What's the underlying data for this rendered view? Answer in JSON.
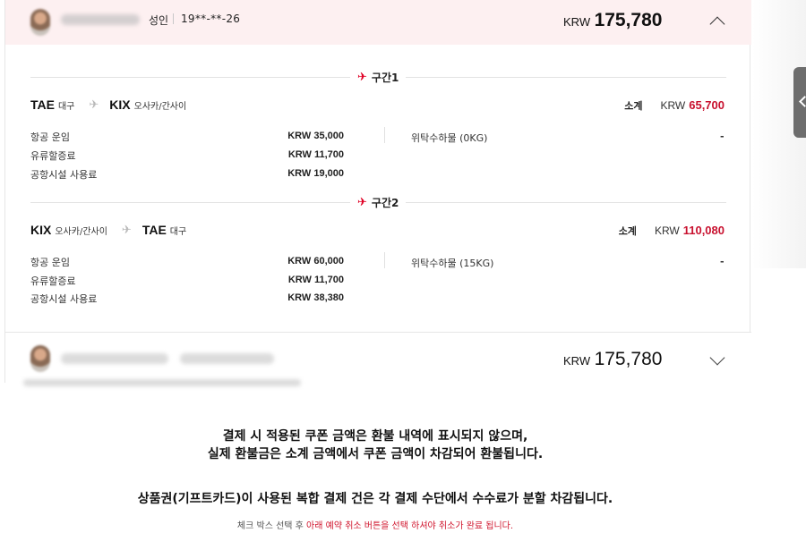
{
  "passenger1": {
    "type": "성인",
    "birth": "19**-**-26",
    "total_currency": "KRW",
    "total_amount": "175,780",
    "expanded": true
  },
  "segments": [
    {
      "title": "구간1",
      "from_code": "TAE",
      "from_city": "대구",
      "to_code": "KIX",
      "to_city": "오사카/간사이",
      "subtotal_label": "소계",
      "subtotal_currency": "KRW",
      "subtotal_amount": "65,700",
      "fees": [
        {
          "label": "항공 운임",
          "value": "KRW 35,000"
        },
        {
          "label": "유류할증료",
          "value": "KRW 11,700"
        },
        {
          "label": "공항시설 사용료",
          "value": "KRW 19,000"
        }
      ],
      "baggage_label": "위탁수하물 (0KG)",
      "baggage_value": "-"
    },
    {
      "title": "구간2",
      "from_code": "KIX",
      "from_city": "오사카/간사이",
      "to_code": "TAE",
      "to_city": "대구",
      "subtotal_label": "소계",
      "subtotal_currency": "KRW",
      "subtotal_amount": "110,080",
      "fees": [
        {
          "label": "항공 운임",
          "value": "KRW 60,000"
        },
        {
          "label": "유류할증료",
          "value": "KRW 11,700"
        },
        {
          "label": "공항시설 사용료",
          "value": "KRW 38,380"
        }
      ],
      "baggage_label": "위탁수하물 (15KG)",
      "baggage_value": "-"
    }
  ],
  "passenger2": {
    "total_currency": "KRW",
    "total_amount": "175,780",
    "expanded": false
  },
  "notices": {
    "coupon_line1": "결제 시 적용된 쿠폰 금액은 환불 내역에 표시되지 않으며,",
    "coupon_line2": "실제 환불금은 소계 금액에서 쿠폰 금액이 차감되어 환불됩니다.",
    "giftcard": "상품권(기프트카드)이 사용된 복합 결제 건은 각 결제 수단에서 수수료가 분할 차감됩니다.",
    "checkbox_grey": "체크 박스 선택 후 ",
    "checkbox_red": "아래 예약 취소 버튼을 선택 하셔야 취소가 완료 됩니다."
  },
  "icons": {
    "segment_plane": "plane-icon",
    "route_plane": "plane-icon",
    "collapse": "chevron-up-icon",
    "expand": "chevron-down-icon",
    "side_tab": "chevron-left-icon"
  },
  "colors": {
    "accent_red": "#c8102e",
    "header_pink": "#fdf0f1"
  }
}
